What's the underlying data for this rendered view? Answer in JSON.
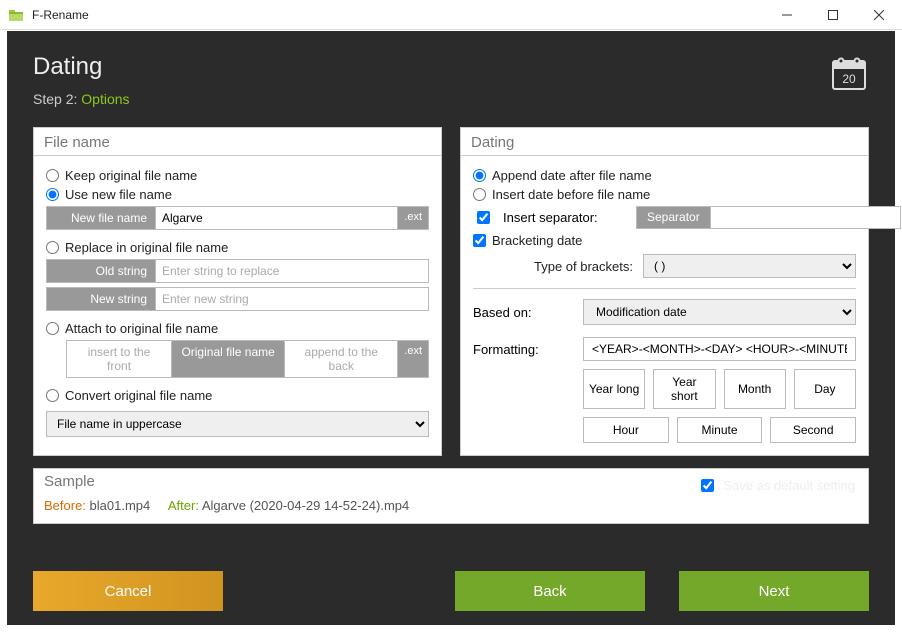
{
  "window": {
    "title": "F-Rename"
  },
  "header": {
    "title": "Dating",
    "step_label": "Step 2: ",
    "step_name": "Options"
  },
  "filename_panel": {
    "title": "File name",
    "keep_original": "Keep original file name",
    "use_new": "Use new file name",
    "new_file_label": "New file name",
    "new_file_value": "Algarve",
    "ext": ".ext",
    "replace": "Replace in original file name",
    "old_string_label": "Old string",
    "old_string_placeholder": "Enter string to replace",
    "new_string_label": "New string",
    "new_string_placeholder": "Enter new string",
    "attach": "Attach to original file name",
    "attach_front": "insert to the front",
    "attach_orig": "Original file name",
    "attach_back": "append to the back",
    "convert": "Convert original file name",
    "convert_option": "File name in uppercase",
    "selected_mode": "use_new"
  },
  "dating_panel": {
    "title": "Dating",
    "append_after": "Append date after file name",
    "insert_before": "Insert date before file name",
    "insert_sep": "Insert separator:",
    "sep_label": "Separator",
    "sep_value": "",
    "bracketing": "Bracketing date",
    "type_brackets": "Type of brackets:",
    "bracket_option": "( )",
    "based_on_label": "Based on:",
    "based_on_value": "Modification date",
    "formatting_label": "Formatting:",
    "formatting_value": "<YEAR>-<MONTH>-<DAY> <HOUR>-<MINUTE>-<SECOND>",
    "btns": {
      "year_long": "Year long",
      "year_short": "Year short",
      "month": "Month",
      "day": "Day",
      "hour": "Hour",
      "minute": "Minute",
      "second": "Second"
    },
    "position": "after",
    "insert_sep_checked": true,
    "bracketing_checked": true
  },
  "sample": {
    "title": "Sample",
    "before_label": "Before:",
    "before_value": "bla01.mp4",
    "after_label": "After:",
    "after_value": "Algarve (2020-04-29 14-52-24).mp4",
    "save_default": "Save as default setting",
    "save_default_checked": true
  },
  "buttons": {
    "cancel": "Cancel",
    "back": "Back",
    "next": "Next"
  }
}
